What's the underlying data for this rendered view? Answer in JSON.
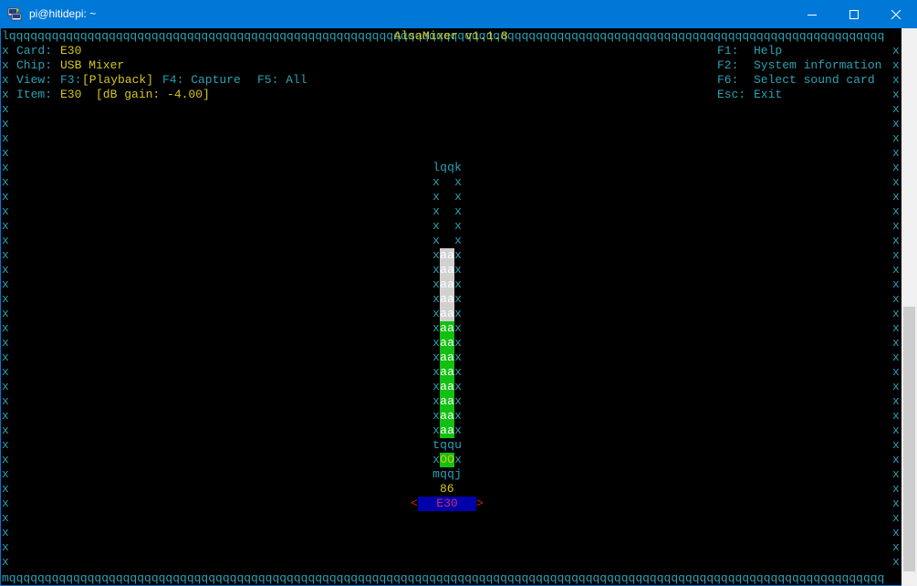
{
  "window": {
    "title": "pi@hitidepi: ~"
  },
  "mixer": {
    "heading": " AlsaMixer v1.1.8 ",
    "card_label": "Card:",
    "card_value": "E30",
    "chip_label": "Chip:",
    "chip_value": "USB Mixer",
    "view_label": "View:",
    "view_f3": "F3:",
    "view_playback": "[Playback]",
    "view_f4": "F4: Capture",
    "view_f5": "F5: All",
    "item_label": "Item:",
    "item_value": "E30  [dB gain: -4.00]",
    "help": [
      {
        "key": "F1:",
        "label": "Help"
      },
      {
        "key": "F2:",
        "label": "System information"
      },
      {
        "key": "F6:",
        "label": "Select sound card"
      },
      {
        "key": "Esc:",
        "label": "Exit"
      }
    ],
    "control": {
      "value": "86",
      "name": "E30",
      "level_percent": 86,
      "mute_state": "OO"
    }
  },
  "colors": {
    "border": "#2aa1b3",
    "highlight_text": "#d6c51c",
    "bar_top": "#d0d0d0",
    "bar_bottom": "#12c012",
    "selected_bg": "#0000aa",
    "selected_text": "#cc2a7a"
  }
}
